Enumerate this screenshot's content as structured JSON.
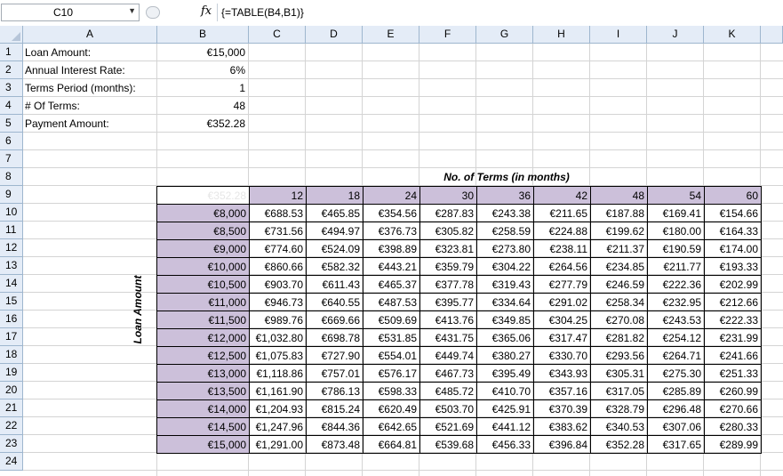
{
  "formula_bar": {
    "name_box": "C10",
    "fx_icon": "fx",
    "formula": "{=TABLE(B4,B1)}"
  },
  "columns": [
    "A",
    "B",
    "C",
    "D",
    "E",
    "F",
    "G",
    "H",
    "I",
    "J",
    "K"
  ],
  "rows": [
    "1",
    "2",
    "3",
    "4",
    "5",
    "6",
    "7",
    "8",
    "9",
    "10",
    "11",
    "12",
    "13",
    "14",
    "15",
    "16",
    "17",
    "18",
    "19",
    "20",
    "21",
    "22",
    "23",
    "24"
  ],
  "inputs": [
    {
      "label": "Loan Amount:",
      "value": "€15,000"
    },
    {
      "label": "Annual Interest Rate:",
      "value": "6%"
    },
    {
      "label": "Terms Period (months):",
      "value": "1"
    },
    {
      "label": "# Of Terms:",
      "value": "48"
    },
    {
      "label": "Payment Amount:",
      "value": "€352.28"
    }
  ],
  "table": {
    "title": "No. of Terms (in months)",
    "row_axis_label": "Loan Amount",
    "corner_value": "€352.28",
    "terms": [
      "12",
      "18",
      "24",
      "30",
      "36",
      "42",
      "48",
      "54",
      "60"
    ],
    "rows": [
      {
        "amount": "€8,000",
        "values": [
          "€688.53",
          "€465.85",
          "€354.56",
          "€287.83",
          "€243.38",
          "€211.65",
          "€187.88",
          "€169.41",
          "€154.66"
        ]
      },
      {
        "amount": "€8,500",
        "values": [
          "€731.56",
          "€494.97",
          "€376.73",
          "€305.82",
          "€258.59",
          "€224.88",
          "€199.62",
          "€180.00",
          "€164.33"
        ]
      },
      {
        "amount": "€9,000",
        "values": [
          "€774.60",
          "€524.09",
          "€398.89",
          "€323.81",
          "€273.80",
          "€238.11",
          "€211.37",
          "€190.59",
          "€174.00"
        ]
      },
      {
        "amount": "€10,000",
        "values": [
          "€860.66",
          "€582.32",
          "€443.21",
          "€359.79",
          "€304.22",
          "€264.56",
          "€234.85",
          "€211.77",
          "€193.33"
        ]
      },
      {
        "amount": "€10,500",
        "values": [
          "€903.70",
          "€611.43",
          "€465.37",
          "€377.78",
          "€319.43",
          "€277.79",
          "€246.59",
          "€222.36",
          "€202.99"
        ]
      },
      {
        "amount": "€11,000",
        "values": [
          "€946.73",
          "€640.55",
          "€487.53",
          "€395.77",
          "€334.64",
          "€291.02",
          "€258.34",
          "€232.95",
          "€212.66"
        ]
      },
      {
        "amount": "€11,500",
        "values": [
          "€989.76",
          "€669.66",
          "€509.69",
          "€413.76",
          "€349.85",
          "€304.25",
          "€270.08",
          "€243.53",
          "€222.33"
        ]
      },
      {
        "amount": "€12,000",
        "values": [
          "€1,032.80",
          "€698.78",
          "€531.85",
          "€431.75",
          "€365.06",
          "€317.47",
          "€281.82",
          "€254.12",
          "€231.99"
        ]
      },
      {
        "amount": "€12,500",
        "values": [
          "€1,075.83",
          "€727.90",
          "€554.01",
          "€449.74",
          "€380.27",
          "€330.70",
          "€293.56",
          "€264.71",
          "€241.66"
        ]
      },
      {
        "amount": "€13,000",
        "values": [
          "€1,118.86",
          "€757.01",
          "€576.17",
          "€467.73",
          "€395.49",
          "€343.93",
          "€305.31",
          "€275.30",
          "€251.33"
        ]
      },
      {
        "amount": "€13,500",
        "values": [
          "€1,161.90",
          "€786.13",
          "€598.33",
          "€485.72",
          "€410.70",
          "€357.16",
          "€317.05",
          "€285.89",
          "€260.99"
        ]
      },
      {
        "amount": "€14,000",
        "values": [
          "€1,204.93",
          "€815.24",
          "€620.49",
          "€503.70",
          "€425.91",
          "€370.39",
          "€328.79",
          "€296.48",
          "€270.66"
        ]
      },
      {
        "amount": "€14,500",
        "values": [
          "€1,247.96",
          "€844.36",
          "€642.65",
          "€521.69",
          "€441.12",
          "€383.62",
          "€340.53",
          "€307.06",
          "€280.33"
        ]
      },
      {
        "amount": "€15,000",
        "values": [
          "€1,291.00",
          "€873.48",
          "€664.81",
          "€539.68",
          "€456.33",
          "€396.84",
          "€352.28",
          "€317.65",
          "€289.99"
        ]
      }
    ]
  }
}
